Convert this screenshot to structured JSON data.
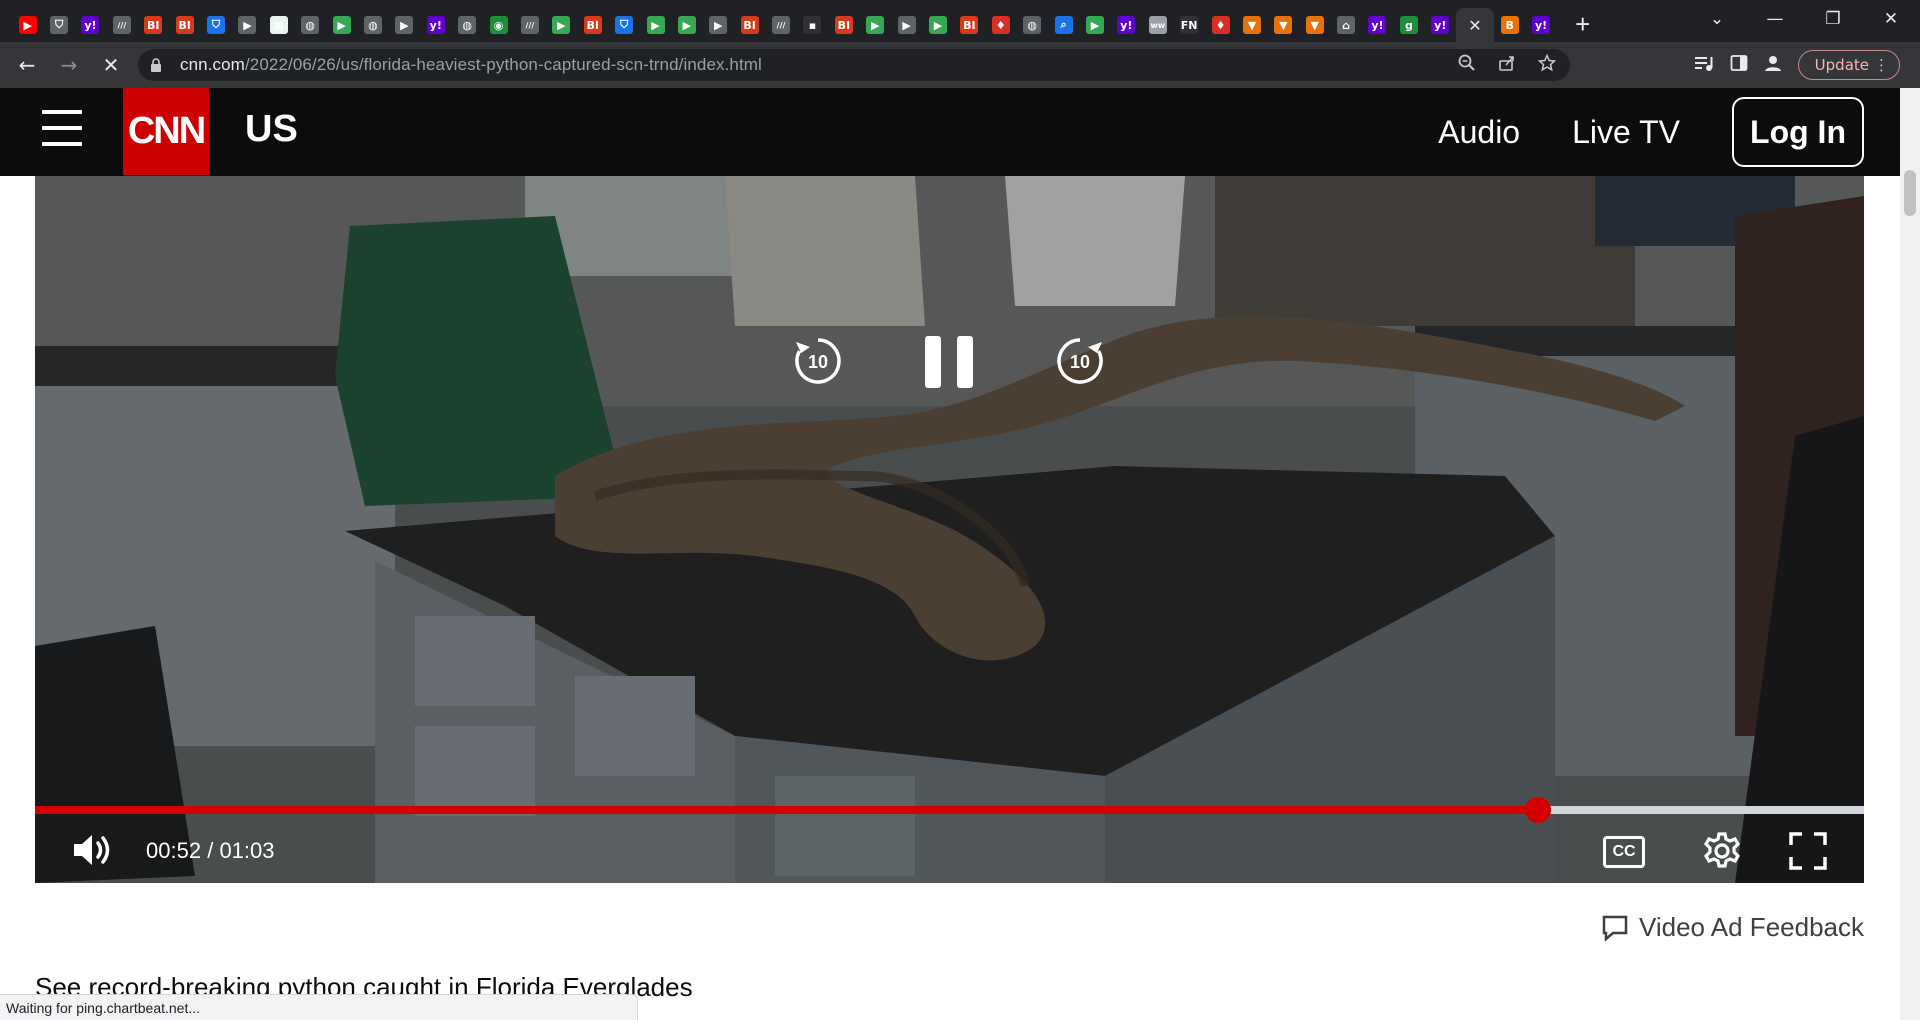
{
  "browser": {
    "tabs": [
      {
        "icon": "youtube-icon",
        "glyph": "▶",
        "color": "#ff0000"
      },
      {
        "icon": "shield-icon",
        "glyph": "⛉",
        "color": "#5f6368"
      },
      {
        "icon": "yahoo-icon",
        "glyph": "y!",
        "color": "#6001d2"
      },
      {
        "icon": "slashes-icon",
        "glyph": "///",
        "color": "#5f6368"
      },
      {
        "icon": "bi-icon",
        "glyph": "BI",
        "color": "#d93a1a"
      },
      {
        "icon": "bi-icon",
        "glyph": "BI",
        "color": "#d93a1a"
      },
      {
        "icon": "shield-icon",
        "glyph": "⛉",
        "color": "#1a73e8"
      },
      {
        "icon": "flag-icon",
        "glyph": "▶",
        "color": "#5f6368"
      },
      {
        "icon": "grid-icon",
        "glyph": "▦",
        "color": "#e8f5e9"
      },
      {
        "icon": "globe-icon",
        "glyph": "◍",
        "color": "#5f6368"
      },
      {
        "icon": "play-icon",
        "glyph": "▶",
        "color": "#34a853"
      },
      {
        "icon": "globe-icon",
        "glyph": "◍",
        "color": "#5f6368"
      },
      {
        "icon": "flag-icon",
        "glyph": "▶",
        "color": "#5f6368"
      },
      {
        "icon": "yahoo-icon",
        "glyph": "y!",
        "color": "#6001d2"
      },
      {
        "icon": "globe-icon",
        "glyph": "◍",
        "color": "#5f6368"
      },
      {
        "icon": "tree-icon",
        "glyph": "◉",
        "color": "#1e8e3e"
      },
      {
        "icon": "slashes-icon",
        "glyph": "///",
        "color": "#5f6368"
      },
      {
        "icon": "play-icon",
        "glyph": "▶",
        "color": "#34a853"
      },
      {
        "icon": "bi-icon",
        "glyph": "BI",
        "color": "#d93a1a"
      },
      {
        "icon": "shield-icon",
        "glyph": "⛉",
        "color": "#1a73e8"
      },
      {
        "icon": "play-icon",
        "glyph": "▶",
        "color": "#34a853"
      },
      {
        "icon": "play-icon",
        "glyph": "▶",
        "color": "#34a853"
      },
      {
        "icon": "flag-icon",
        "glyph": "▶",
        "color": "#5f6368"
      },
      {
        "icon": "bi-icon",
        "glyph": "BI",
        "color": "#d93a1a"
      },
      {
        "icon": "slashes-icon",
        "glyph": "///",
        "color": "#5f6368"
      },
      {
        "icon": "dark-icon",
        "glyph": "▪",
        "color": "#303134"
      },
      {
        "icon": "bi-icon",
        "glyph": "BI",
        "color": "#d93a1a"
      },
      {
        "icon": "play-icon",
        "glyph": "▶",
        "color": "#34a853"
      },
      {
        "icon": "flag-icon",
        "glyph": "▶",
        "color": "#5f6368"
      },
      {
        "icon": "play-icon",
        "glyph": "▶",
        "color": "#34a853"
      },
      {
        "icon": "bi-icon",
        "glyph": "BI",
        "color": "#d93a1a"
      },
      {
        "icon": "mic-icon",
        "glyph": "♦",
        "color": "#d93025"
      },
      {
        "icon": "globe-icon",
        "glyph": "◍",
        "color": "#5f6368"
      },
      {
        "icon": "search-icon",
        "glyph": "⌕",
        "color": "#1a73e8"
      },
      {
        "icon": "play-icon",
        "glyph": "▶",
        "color": "#34a853"
      },
      {
        "icon": "yahoo-icon",
        "glyph": "y!",
        "color": "#6001d2"
      },
      {
        "icon": "ww-icon",
        "glyph": "ww",
        "color": "#9aa0a6"
      },
      {
        "icon": "fn-icon",
        "glyph": "FN",
        "color": "#303134"
      },
      {
        "icon": "mic-icon",
        "glyph": "♦",
        "color": "#d93025"
      },
      {
        "icon": "bookmark-icon",
        "glyph": "▼",
        "color": "#e8710a"
      },
      {
        "icon": "bookmark-icon",
        "glyph": "▼",
        "color": "#e8710a"
      },
      {
        "icon": "bookmark-icon",
        "glyph": "▼",
        "color": "#e8710a"
      },
      {
        "icon": "house-icon",
        "glyph": "⌂",
        "color": "#5f6368"
      },
      {
        "icon": "yahoo-icon",
        "glyph": "y!",
        "color": "#6001d2"
      },
      {
        "icon": "g-icon",
        "glyph": "g",
        "color": "#1e8e3e"
      },
      {
        "icon": "yahoo-icon",
        "glyph": "y!",
        "color": "#6001d2"
      },
      {
        "icon": "close-icon",
        "glyph": "✕",
        "color": "#35363a",
        "active": true
      },
      {
        "icon": "b-icon",
        "glyph": "B",
        "color": "#e8710a"
      },
      {
        "icon": "yahoo-icon",
        "glyph": "y!",
        "color": "#6001d2"
      }
    ],
    "window_controls": [
      "⌄",
      "—",
      "❐",
      "✕"
    ],
    "url_host": "cnn.com",
    "url_path": "/2022/06/26/us/florida-heaviest-python-captured-scn-trnd/index.html",
    "update_label": "Update",
    "status_text": "Waiting for ping.chartbeat.net..."
  },
  "cnn_header": {
    "logo_text": "CNN",
    "section": "US",
    "nav": [
      "Audio",
      "Live TV"
    ],
    "login_label": "Log In"
  },
  "video": {
    "seek_back_label": "10",
    "seek_forward_label": "10",
    "current_time": "00:52",
    "separator": "/",
    "duration": "01:03",
    "progress": 0.822,
    "cc_label": "CC",
    "accent_color": "#d40000"
  },
  "feedback_label": "Video Ad Feedback",
  "caption": "See record-breaking python caught in Florida Everglades"
}
